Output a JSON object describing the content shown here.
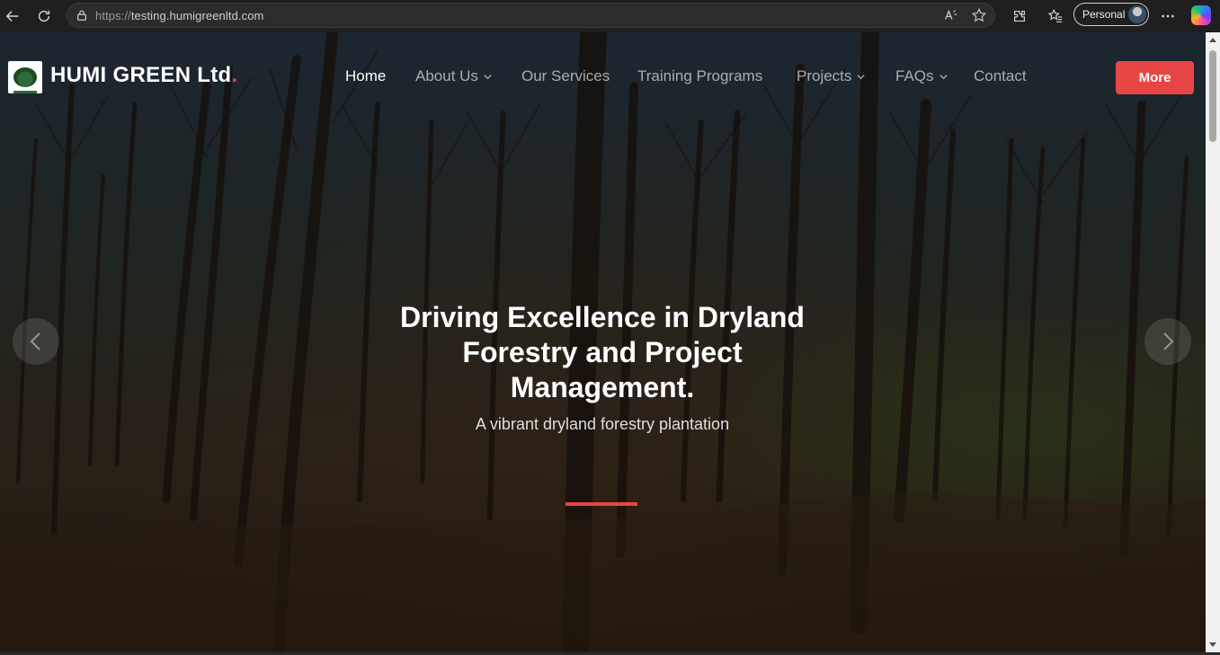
{
  "browser": {
    "url_protocol": "https://",
    "url_host": "testing.humigreenltd.com",
    "profile_label": "Personal",
    "icons": [
      "back-icon",
      "refresh-icon",
      "lock-icon",
      "read-aloud-icon",
      "favorite-star-icon",
      "extensions-icon",
      "favorites-icon",
      "more-menu-icon",
      "copilot-icon"
    ]
  },
  "header": {
    "brand_name": "HUMI GREEN Ltd",
    "brand_dot": ".",
    "nav": [
      {
        "label": "Home",
        "active": true,
        "has_dropdown": false
      },
      {
        "label": "About Us",
        "active": false,
        "has_dropdown": true
      },
      {
        "label": "Our Services",
        "active": false,
        "has_dropdown": false
      },
      {
        "label": "Training Programs",
        "active": false,
        "has_dropdown": false
      },
      {
        "label": "Projects",
        "active": false,
        "has_dropdown": true
      },
      {
        "label": "FAQs",
        "active": false,
        "has_dropdown": true
      },
      {
        "label": "Contact",
        "active": false,
        "has_dropdown": false
      }
    ],
    "cta_label": "More"
  },
  "hero": {
    "title_lines": [
      "Driving Excellence in Dryland",
      "Forestry and Project",
      "Management."
    ],
    "subtitle": "A vibrant dryland forestry plantation"
  },
  "colors": {
    "accent": "#e84545",
    "text": "#ffffff"
  }
}
